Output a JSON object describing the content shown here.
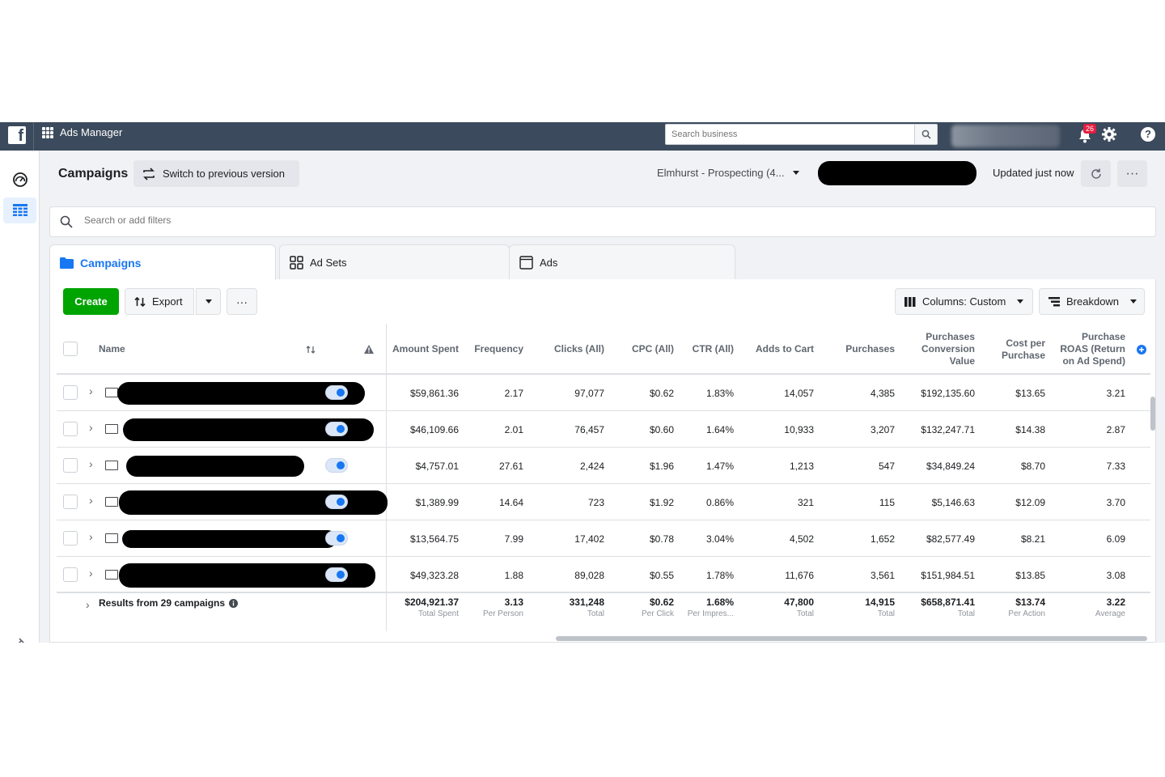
{
  "topbar": {
    "logo_letter": "f",
    "app_title": "Ads Manager",
    "search_placeholder": "Search business",
    "notifications_count": "26"
  },
  "header": {
    "title": "Campaigns",
    "switch_label": "Switch to previous version",
    "account": "Elmhurst - Prospecting (4...",
    "updated": "Updated just now"
  },
  "filter": {
    "placeholder": "Search or add filters"
  },
  "tabs": [
    {
      "label": "Campaigns",
      "icon": "folder-icon"
    },
    {
      "label": "Ad Sets",
      "icon": "grid-icon"
    },
    {
      "label": "Ads",
      "icon": "ad-icon"
    }
  ],
  "toolbar": {
    "create": "Create",
    "export": "Export",
    "more": "···",
    "columns": "Columns: Custom",
    "breakdown": "Breakdown"
  },
  "table": {
    "columns": [
      "Name",
      "Amount Spent",
      "Frequency",
      "Clicks (All)",
      "CPC (All)",
      "CTR (All)",
      "Adds to Cart",
      "Purchases",
      "Purchases Conversion Value",
      "Cost per Purchase",
      "Purchase ROAS (Return on Ad Spend)"
    ],
    "rows": [
      [
        "$59,861.36",
        "2.17",
        "97,077",
        "$0.62",
        "1.83%",
        "14,057",
        "4,385",
        "$192,135.60",
        "$13.65",
        "3.21"
      ],
      [
        "$46,109.66",
        "2.01",
        "76,457",
        "$0.60",
        "1.64%",
        "10,933",
        "3,207",
        "$132,247.71",
        "$14.38",
        "2.87"
      ],
      [
        "$4,757.01",
        "27.61",
        "2,424",
        "$1.96",
        "1.47%",
        "1,213",
        "547",
        "$34,849.24",
        "$8.70",
        "7.33"
      ],
      [
        "$1,389.99",
        "14.64",
        "723",
        "$1.92",
        "0.86%",
        "321",
        "115",
        "$5,146.63",
        "$12.09",
        "3.70"
      ],
      [
        "$13,564.75",
        "7.99",
        "17,402",
        "$0.78",
        "3.04%",
        "4,502",
        "1,652",
        "$82,577.49",
        "$8.21",
        "6.09"
      ],
      [
        "$49,323.28",
        "1.88",
        "89,028",
        "$0.55",
        "1.78%",
        "11,676",
        "3,561",
        "$151,984.51",
        "$13.85",
        "3.08"
      ]
    ],
    "totals_label": "Results from 29 campaigns",
    "totals": [
      {
        "value": "$204,921.37",
        "label": "Total Spent"
      },
      {
        "value": "3.13",
        "label": "Per Person"
      },
      {
        "value": "331,248",
        "label": "Total"
      },
      {
        "value": "$0.62",
        "label": "Per Click"
      },
      {
        "value": "1.68%",
        "label": "Per Impres..."
      },
      {
        "value": "47,800",
        "label": "Total"
      },
      {
        "value": "14,915",
        "label": "Total"
      },
      {
        "value": "$658,871.41",
        "label": "Total"
      },
      {
        "value": "$13.74",
        "label": "Per Action"
      },
      {
        "value": "3.22",
        "label": "Average"
      }
    ]
  },
  "colors": {
    "accent": "#1877f2",
    "create_green": "#00a400",
    "topbar": "#3b4a5c"
  }
}
